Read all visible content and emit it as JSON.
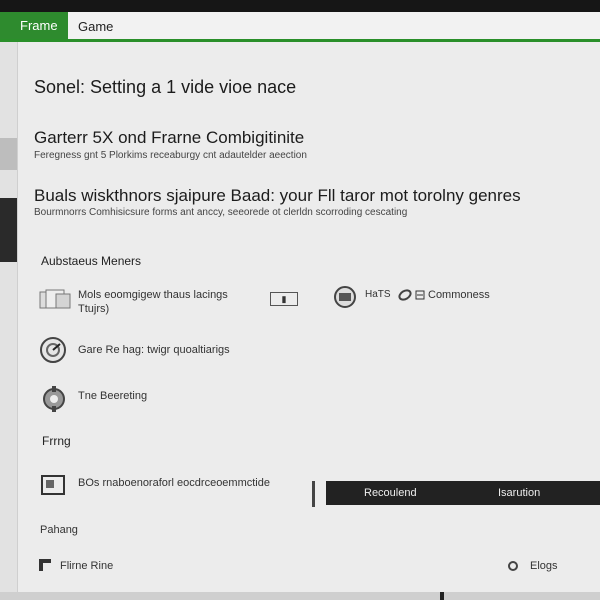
{
  "tabs": {
    "active": "Frame",
    "other": "Game"
  },
  "main": {
    "title": "Sonel: Setting a 1 vide vioe nace",
    "section1": {
      "title": "Garterr 5X ond Frarne Combigitinite",
      "subtitle": "Feregness gnt 5 Plorkims receaburgy cnt adautelder aeection"
    },
    "section2": {
      "title": "Buals wiskthnors sjaipure Baad: your Fll taror mot torolny genres",
      "subtitle": "Bourmnorrs Comhisicsure forms ant anccy, seeorede ot clerldn scorroding cescating"
    }
  },
  "list": {
    "header": "Aubstaeus Meners",
    "row1": {
      "label": "Mols eoomgigew thaus lacings",
      "sub": "Ttujrs)",
      "value_box": "▮",
      "right_prefix": "HaTS",
      "right_label": "Commoness"
    },
    "row2": {
      "label": "Gare Re hag: twigr quoaltiarigs"
    },
    "row3": {
      "label": "Tne Beereting"
    },
    "section_label": "Frrng",
    "row4": {
      "label": "BOs   rnaboenoraforl eocdrceoemmctide"
    },
    "footer_label": "Pahang"
  },
  "buttons": {
    "primary": "Recoulend",
    "secondary": "Isarution"
  },
  "bottom": {
    "left_label": "Flirne Rine",
    "right_label": "Elogs"
  },
  "colors": {
    "accent": "#2e8b2e",
    "panel": "#ececec",
    "dark": "#222222"
  }
}
